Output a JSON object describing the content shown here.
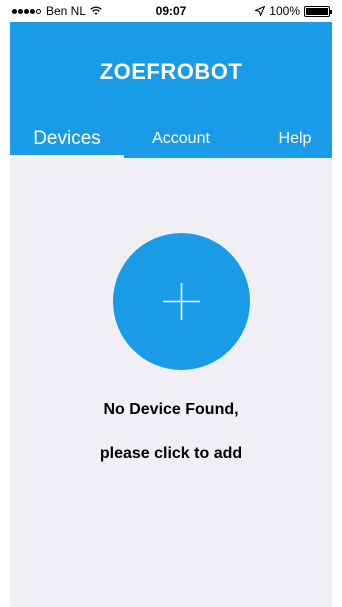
{
  "status_bar": {
    "carrier": "Ben NL",
    "time": "09:07",
    "battery": "100%"
  },
  "header": {
    "title": "ZOEFROBOT"
  },
  "tabs": [
    {
      "label": "Devices",
      "active": true
    },
    {
      "label": "Account",
      "active": false
    },
    {
      "label": "Help",
      "active": false
    }
  ],
  "main": {
    "empty_line1": "No Device Found,",
    "empty_line2": "please click to add"
  },
  "colors": {
    "brand": "#1a9be8",
    "background": "#efeff4"
  },
  "icons": {
    "add": "plus-icon",
    "wifi": "wifi-icon",
    "location": "location-arrow-icon",
    "battery": "battery-icon"
  }
}
